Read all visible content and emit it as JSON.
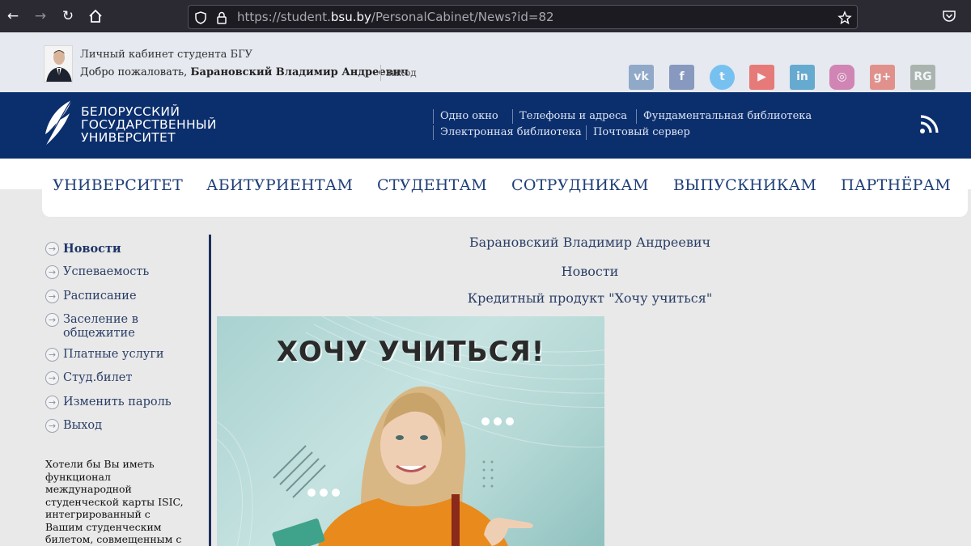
{
  "browser": {
    "url_prefix": "https://student.",
    "url_host": "bsu.by",
    "url_path": "/PersonalCabinet/News?id=82"
  },
  "topbar": {
    "cabinet_title": "Личный кабинет студента БГУ",
    "welcome_prefix": "Добро пожаловать,",
    "user_name": "Барановский Владимир Андреевич",
    "logout_label": "выход"
  },
  "social": [
    {
      "name": "vk-icon",
      "label": "vk",
      "color": "#4a76a8"
    },
    {
      "name": "facebook-icon",
      "label": "f",
      "color": "#3b5998"
    },
    {
      "name": "twitter-icon",
      "label": "t",
      "color": "#1da1f2"
    },
    {
      "name": "youtube-icon",
      "label": "▶",
      "color": "#e62117"
    },
    {
      "name": "linkedin-icon",
      "label": "in",
      "color": "#0077b5"
    },
    {
      "name": "instagram-icon",
      "label": "◎",
      "color": "#c13584"
    },
    {
      "name": "googleplus-icon",
      "label": "g+",
      "color": "#dd4b39"
    },
    {
      "name": "researchgate-icon",
      "label": "RG",
      "color": "#7a8a7a"
    }
  ],
  "header": {
    "logo_line1": "БЕЛОРУССКИЙ",
    "logo_line2": "ГОСУДАРСТВЕННЫЙ",
    "logo_line3": "УНИВЕРСИТЕТ",
    "links": [
      "Одно окно",
      "Телефоны и адреса",
      "Фундаментальная библиотека",
      "Электронная библиотека",
      "Почтовый сервер"
    ]
  },
  "menu": [
    "УНИВЕРСИТЕТ",
    "АБИТУРИЕНТАМ",
    "СТУДЕНТАМ",
    "СОТРУДНИКАМ",
    "ВЫПУСКНИКАМ",
    "ПАРТНЁРАМ"
  ],
  "sidebar": {
    "items": [
      "Новости",
      "Успеваемость",
      "Расписание",
      "Заселение в",
      "общежитие",
      "Платные услуги",
      "Студ.билет",
      "Изменить пароль",
      "Выход"
    ],
    "active_index": 0,
    "note": "Хотели бы Вы иметь функционал международной студенческой карты ISIC, интегрированный с Вашим студенческим билетом, совмещенным с банковской картой?"
  },
  "content": {
    "student_name": "Барановский Владимир Андреевич",
    "section": "Новости",
    "news_title": "Кредитный продукт \"Хочу учиться\"",
    "banner_title": "ХОЧУ УЧИТЬСЯ!"
  },
  "colors": {
    "header_blue": "#0b2e6d",
    "link_blue": "#1f3f78"
  }
}
